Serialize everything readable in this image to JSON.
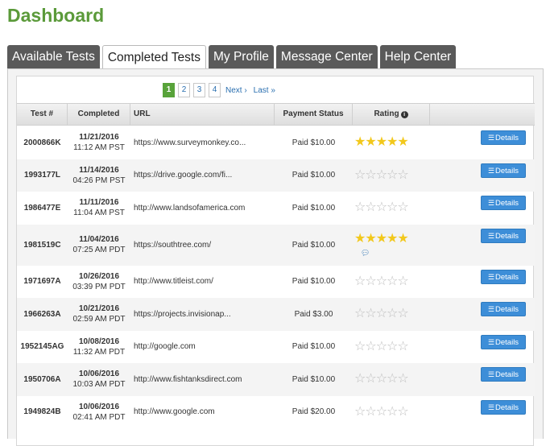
{
  "page": {
    "title": "Dashboard"
  },
  "tabs": [
    {
      "label": "Available Tests",
      "active": false
    },
    {
      "label": "Completed Tests",
      "active": true
    },
    {
      "label": "My Profile",
      "active": false
    },
    {
      "label": "Message Center",
      "active": false
    },
    {
      "label": "Help Center",
      "active": false
    }
  ],
  "pagination": {
    "pages": [
      "1",
      "2",
      "3",
      "4"
    ],
    "current": "1",
    "next": "Next ›",
    "last": "Last »"
  },
  "table": {
    "headers": {
      "test_num": "Test #",
      "completed": "Completed",
      "url": "URL",
      "payment": "Payment Status",
      "rating": "Rating"
    },
    "details_label": "Details",
    "rows": [
      {
        "id": "2000866K",
        "date": "11/21/2016",
        "time": "11:12 AM PST",
        "url": "https://www.surveymonkey.co...",
        "payment": "Paid $10.00",
        "rating": 5,
        "comment": false
      },
      {
        "id": "1993177L",
        "date": "11/14/2016",
        "time": "04:26 PM PST",
        "url": "https://drive.google.com/fi...",
        "payment": "Paid $10.00",
        "rating": 0,
        "comment": false
      },
      {
        "id": "1986477E",
        "date": "11/11/2016",
        "time": "11:04 AM PST",
        "url": "http://www.landsofamerica.com",
        "payment": "Paid $10.00",
        "rating": 0,
        "comment": false
      },
      {
        "id": "1981519C",
        "date": "11/04/2016",
        "time": "07:25 AM PDT",
        "url": "https://southtree.com/",
        "payment": "Paid $10.00",
        "rating": 5,
        "comment": true
      },
      {
        "id": "1971697A",
        "date": "10/26/2016",
        "time": "03:39 PM PDT",
        "url": "http://www.titleist.com/",
        "payment": "Paid $10.00",
        "rating": 0,
        "comment": false
      },
      {
        "id": "1966263A",
        "date": "10/21/2016",
        "time": "02:59 AM PDT",
        "url": "https://projects.invisionap...",
        "payment": "Paid $3.00",
        "rating": 0,
        "comment": false
      },
      {
        "id": "1952145AG",
        "date": "10/08/2016",
        "time": "11:32 AM PDT",
        "url": "http://google.com",
        "payment": "Paid $10.00",
        "rating": 0,
        "comment": false
      },
      {
        "id": "1950706A",
        "date": "10/06/2016",
        "time": "10:03 AM PDT",
        "url": "http://www.fishtanksdirect.com",
        "payment": "Paid $10.00",
        "rating": 0,
        "comment": false
      },
      {
        "id": "1949824B",
        "date": "10/06/2016",
        "time": "02:41 AM PDT",
        "url": "http://www.google.com",
        "payment": "Paid $20.00",
        "rating": 0,
        "comment": false
      }
    ]
  },
  "icons": {
    "info": "info-circle-icon",
    "star": "star-icon",
    "details": "list-icon",
    "comment": "comment-icon"
  },
  "colors": {
    "title": "#5b9a3a",
    "tab_bg": "#5a5a5a",
    "page_active": "#58a33a",
    "button": "#3d8ed8",
    "star": "#f2c81c"
  }
}
